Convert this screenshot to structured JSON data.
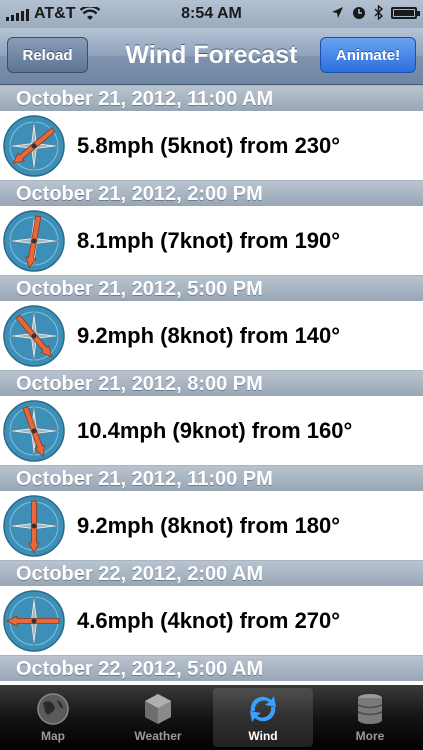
{
  "status": {
    "carrier": "AT&T",
    "time": "8:54 AM"
  },
  "nav": {
    "title": "Wind Forecast",
    "reload_label": "Reload",
    "animate_label": "Animate!"
  },
  "forecasts": [
    {
      "date": "October 21, 2012, 11:00 AM",
      "text": "5.8mph (5knot) from 230°",
      "direction_deg": 230
    },
    {
      "date": "October 21, 2012, 2:00 PM",
      "text": "8.1mph (7knot) from 190°",
      "direction_deg": 190
    },
    {
      "date": "October 21, 2012, 5:00 PM",
      "text": "9.2mph (8knot) from 140°",
      "direction_deg": 140
    },
    {
      "date": "October 21, 2012, 8:00 PM",
      "text": "10.4mph (9knot) from 160°",
      "direction_deg": 160
    },
    {
      "date": "October 21, 2012, 11:00 PM",
      "text": "9.2mph (8knot) from 180°",
      "direction_deg": 180
    },
    {
      "date": "October 22, 2012, 2:00 AM",
      "text": "4.6mph (4knot) from 270°",
      "direction_deg": 270
    },
    {
      "date": "October 22, 2012, 5:00 AM",
      "text": "",
      "direction_deg": null
    }
  ],
  "tabs": [
    {
      "label": "Map",
      "icon": "globe-icon"
    },
    {
      "label": "Weather",
      "icon": "cube-icon"
    },
    {
      "label": "Wind",
      "icon": "refresh-arrows-icon"
    },
    {
      "label": "More",
      "icon": "database-stack-icon"
    }
  ],
  "colors": {
    "accent": "#2b6fe0",
    "compass": "#3d8fb8",
    "arrow": "#e8683a"
  }
}
